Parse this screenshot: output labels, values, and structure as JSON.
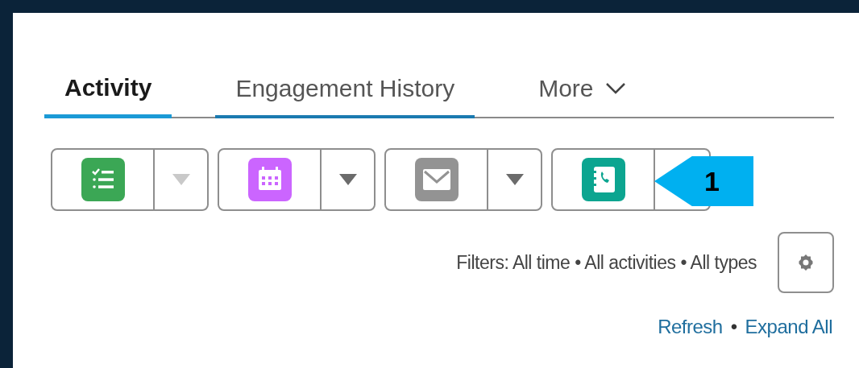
{
  "tabs": [
    {
      "label": "Activity",
      "selected": true,
      "focused": false
    },
    {
      "label": "Engagement History",
      "selected": false,
      "focused": true
    },
    {
      "label": "More",
      "selected": false,
      "focused": false,
      "kind": "menu"
    }
  ],
  "actions": [
    {
      "kind": "task",
      "color": "#3ba755",
      "menu_disabled": true
    },
    {
      "kind": "event",
      "color": "#cb65ff",
      "menu_disabled": false
    },
    {
      "kind": "email",
      "color": "#939393",
      "menu_disabled": false
    },
    {
      "kind": "call",
      "color": "#0ca590"
    }
  ],
  "callout": {
    "label": "1"
  },
  "filters": "Filters: All time • All activities • All types",
  "links": [
    {
      "label": "Refresh"
    },
    {
      "label": "Expand All"
    }
  ],
  "link_separator": "•"
}
